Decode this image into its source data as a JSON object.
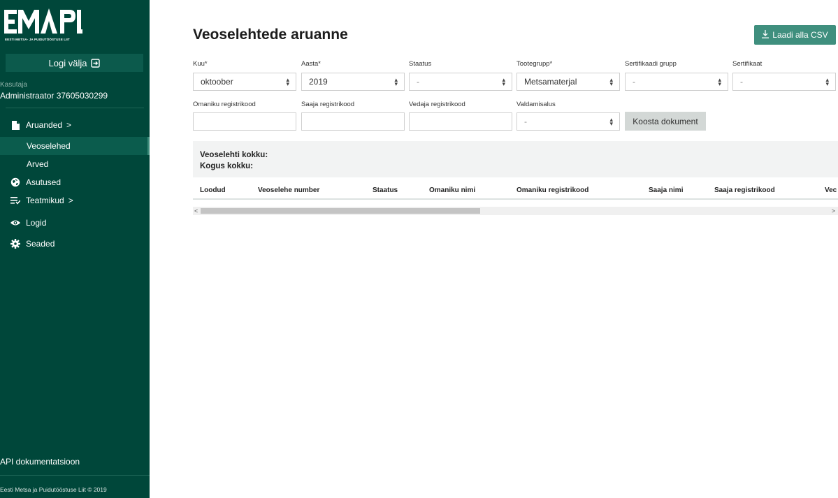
{
  "sidebar": {
    "logo_caption": "EESTI METSA- JA PUIDUTÖÖSTUSE LIIT",
    "logout_label": "Logi välja",
    "user_label": "Kasutaja",
    "user_name": "Administraator 37605030299",
    "nav": [
      {
        "label": "Aruanded",
        "chevron": ">",
        "icon": "document-icon"
      },
      {
        "label": "Veoselehed",
        "active": true
      },
      {
        "label": "Arved"
      },
      {
        "label": "Asutused",
        "icon": "globe-icon"
      },
      {
        "label": "Teatmikud",
        "chevron": ">",
        "icon": "list-icon"
      },
      {
        "label": "Logid",
        "icon": "eye-icon"
      },
      {
        "label": "Seaded",
        "icon": "gear-icon"
      }
    ],
    "api_link": "API dokumentatsioon",
    "footer": "Eesti Metsa ja Puidutööstuse Liit © 2019"
  },
  "main": {
    "title": "Veoselehtede aruanne",
    "csv_button": "Laadi alla CSV",
    "filters_row1": [
      {
        "label": "Kuu*",
        "value": "oktoober"
      },
      {
        "label": "Aasta*",
        "value": "2019"
      },
      {
        "label": "Staatus",
        "value": "-"
      },
      {
        "label": "Tootegrupp*",
        "value": "Metsamaterjal"
      },
      {
        "label": "Sertifikaadi grupp",
        "value": "-"
      },
      {
        "label": "Sertifikaat",
        "value": "-"
      }
    ],
    "filters_row2": [
      {
        "label": "Omaniku registrikood",
        "value": ""
      },
      {
        "label": "Saaja registrikood",
        "value": ""
      },
      {
        "label": "Vedaja registrikood",
        "value": ""
      },
      {
        "label": "Valdamisalus",
        "value": "-"
      }
    ],
    "compose_button": "Koosta dokument",
    "summary": {
      "total_sheets": "Veoselehti kokku:",
      "total_amount": "Kogus kokku:"
    },
    "table_columns": [
      "Loodud",
      "Veoselehe number",
      "Staatus",
      "Omaniku nimi",
      "Omaniku registrikood",
      "Saaja nimi",
      "Saaja registrikood",
      "Vec"
    ]
  }
}
